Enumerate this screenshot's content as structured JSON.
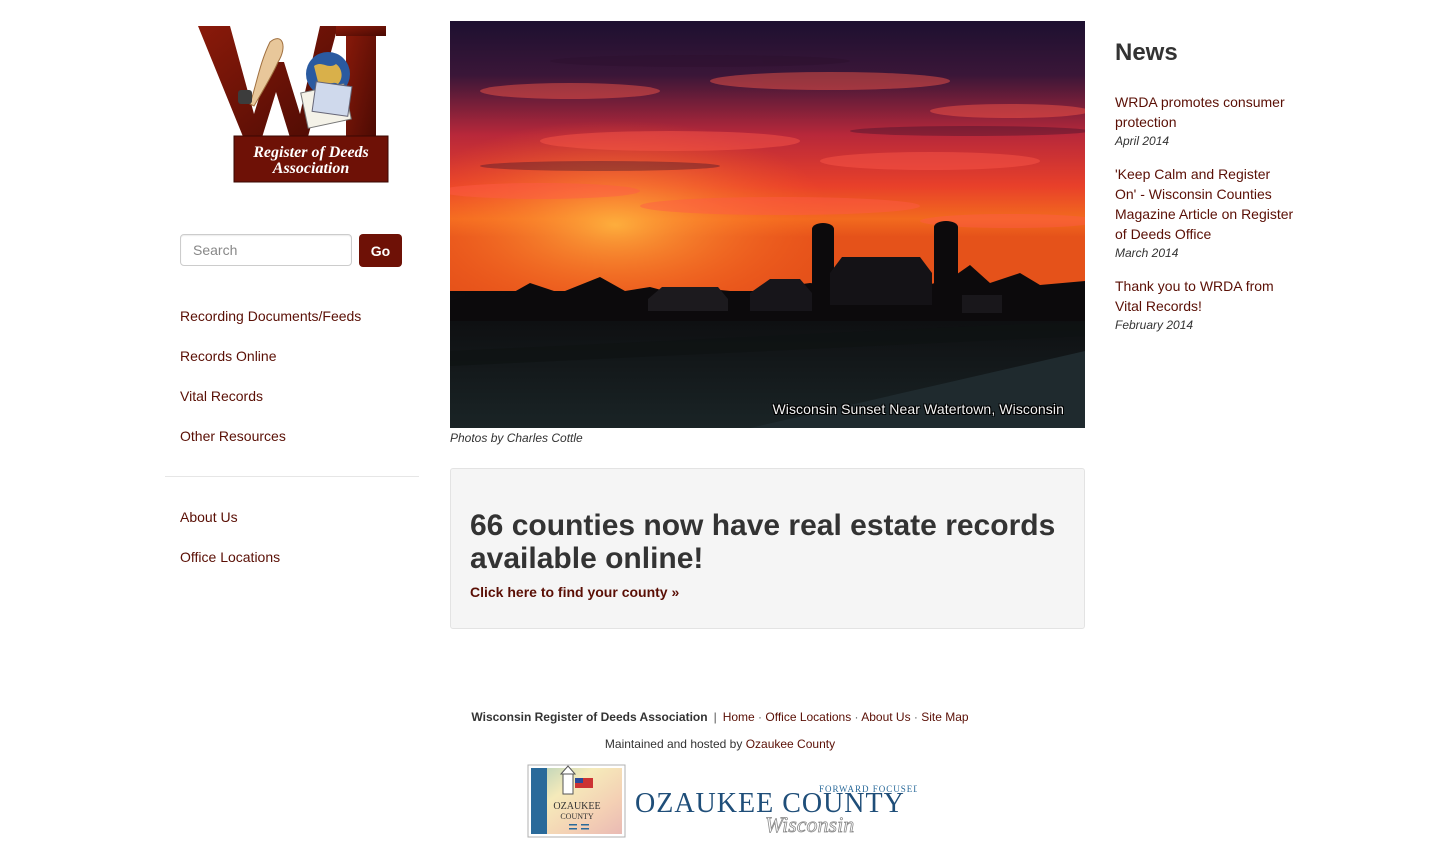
{
  "logo": {
    "monogram": "WI",
    "line1": "Register of Deeds",
    "line2": "Association"
  },
  "search": {
    "placeholder": "Search",
    "button_label": "Go"
  },
  "nav_main": [
    {
      "label": "Recording Documents/Feeds"
    },
    {
      "label": "Records Online"
    },
    {
      "label": "Vital Records"
    },
    {
      "label": "Other Resources"
    }
  ],
  "nav_secondary": [
    {
      "label": "About Us"
    },
    {
      "label": "Office Locations"
    }
  ],
  "hero": {
    "caption": "Wisconsin Sunset Near Watertown, Wisconsin",
    "credit": "Photos by Charles Cottle"
  },
  "callout": {
    "heading": "66 counties now have real estate records available online!",
    "link": "Click here to find your county »"
  },
  "news": {
    "heading": "News",
    "items": [
      {
        "title": "WRDA promotes consumer protection",
        "date": "April 2014"
      },
      {
        "title": "'Keep Calm and Register On' - Wisconsin Counties Magazine Article on Register of Deeds Office",
        "date": "March 2014"
      },
      {
        "title": "Thank you to WRDA from Vital Records!",
        "date": "February 2014"
      }
    ]
  },
  "footer": {
    "org": "Wisconsin Register of Deeds Association",
    "separator": "|",
    "links": [
      "Home",
      "Office Locations",
      "About Us",
      "Site Map"
    ],
    "hosted_prefix": "Maintained and hosted by ",
    "hosted_link": "Ozaukee County",
    "county_logo": {
      "tagline": "FORWARD FOCUSED",
      "name": "OZAUKEE COUNTY",
      "state": "Wisconsin",
      "badge_line1": "OZAUKEE",
      "badge_line2": "COUNTY"
    }
  },
  "colors": {
    "brand": "#6e1106",
    "link": "#5a0f05",
    "county_blue": "#1f4e79"
  }
}
